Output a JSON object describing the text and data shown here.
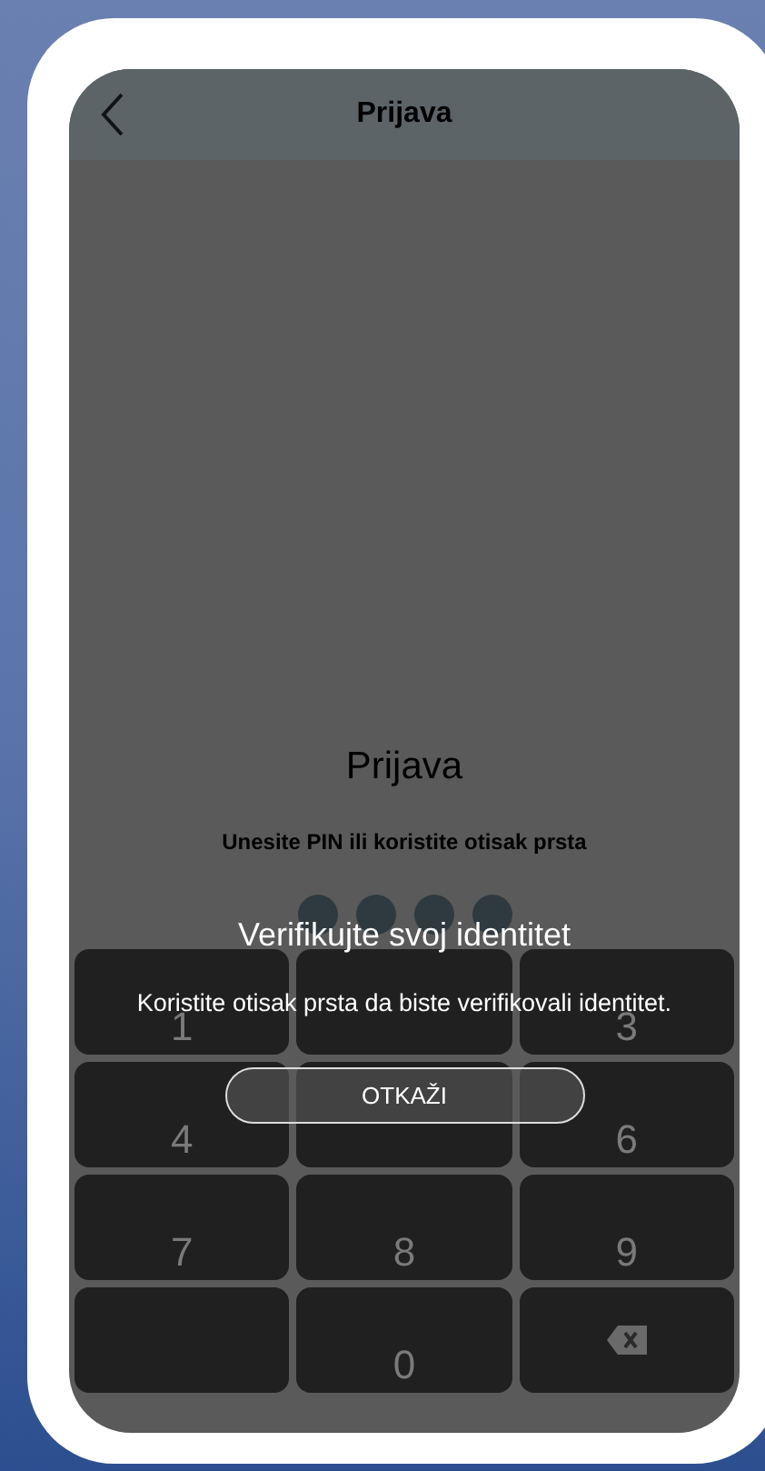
{
  "header": {
    "title": "Prijava"
  },
  "login": {
    "heading": "Prijava",
    "subtitle": "Unesite PIN ili koristite otisak prsta",
    "pin_dots": [
      {
        "filled": false
      },
      {
        "filled": false
      },
      {
        "filled": false
      },
      {
        "filled": false
      }
    ]
  },
  "keypad": [
    {
      "kind": "digit",
      "label": "1"
    },
    {
      "kind": "covered"
    },
    {
      "kind": "digit",
      "label": "3"
    },
    {
      "kind": "digit",
      "label": "4"
    },
    {
      "kind": "covered"
    },
    {
      "kind": "digit",
      "label": "6"
    },
    {
      "kind": "digit",
      "label": "7"
    },
    {
      "kind": "digit",
      "label": "8"
    },
    {
      "kind": "digit",
      "label": "9"
    },
    {
      "kind": "blank"
    },
    {
      "kind": "digit",
      "label": "0"
    },
    {
      "kind": "backspace"
    }
  ],
  "dialog": {
    "title": "Verifikujte svoj identitet",
    "message": "Koristite otisak prsta da biste verifikovali identitet.",
    "cancel_button": "OTKAŽI"
  }
}
